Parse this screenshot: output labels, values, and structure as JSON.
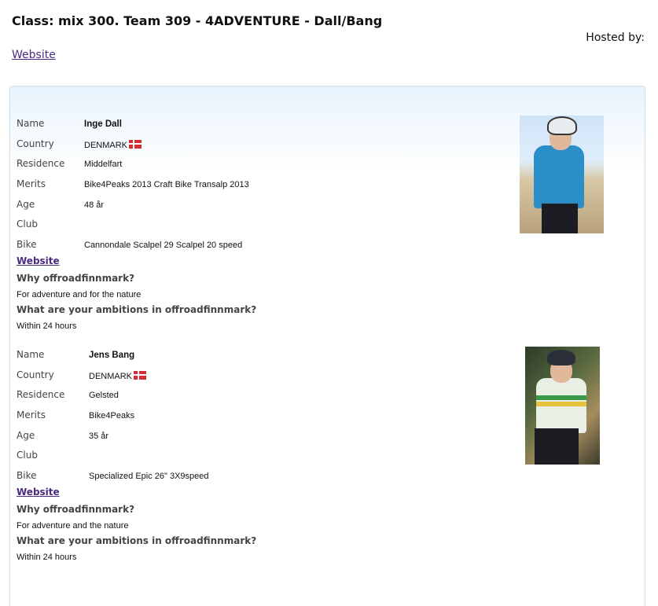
{
  "header": {
    "title": "Class: mix 300. Team 309 - 4ADVENTURE - Dall/Bang",
    "hosted_by": "Hosted by:",
    "website_link": "Website"
  },
  "labels": {
    "name": "Name",
    "country": "Country",
    "residence": "Residence",
    "merits": "Merits",
    "age": "Age",
    "club": "Club",
    "bike": "Bike",
    "website": "Website",
    "why": "Why offroadfinnmark?",
    "ambitions": "What are your ambitions in offroadfinnmark?"
  },
  "participants": [
    {
      "name": "Inge Dall",
      "country": "DENMARK",
      "flag_icon": "denmark-flag-icon",
      "residence": "Middelfart",
      "merits": "Bike4Peaks 2013 Craft Bike Transalp 2013",
      "age": "48 år",
      "club": "",
      "bike": "Cannondale Scalpel 29 Scalpel 20 speed",
      "why_answer": "For adventure and for the nature",
      "ambitions_answer": "Within 24 hours"
    },
    {
      "name": "Jens Bang",
      "country": "DENMARK",
      "flag_icon": "denmark-flag-icon",
      "residence": "Gelsted",
      "merits": "Bike4Peaks",
      "age": "35 år",
      "club": "",
      "bike": "Specialized Epic 26\" 3X9speed",
      "why_answer": "For adventure and the nature",
      "ambitions_answer": "Within 24 hours"
    }
  ],
  "colors": {
    "link": "#4b2a82",
    "panel_border": "#cfe0ee",
    "panel_gradient_top": "#e6f3fd"
  }
}
